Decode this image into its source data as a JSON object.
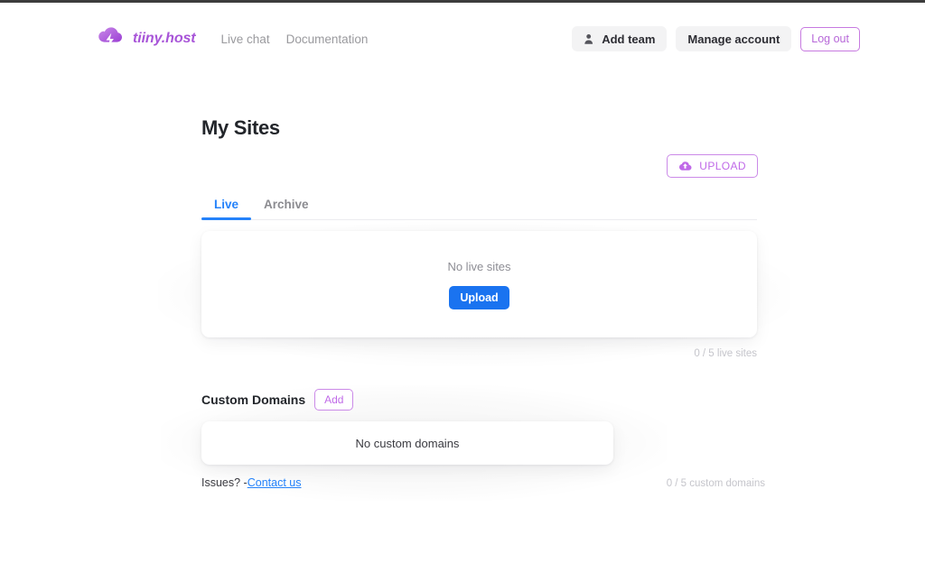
{
  "brand": {
    "name": "tiiny.host",
    "logo_icon": "cloud-bolt-icon",
    "accent_purple": "#b768d8"
  },
  "header": {
    "nav_links": [
      {
        "label": "Live chat"
      },
      {
        "label": "Documentation"
      }
    ],
    "actions": {
      "add_team_label": "Add team",
      "add_team_icon": "user-icon",
      "manage_account_label": "Manage account",
      "log_out_label": "Log out"
    }
  },
  "main": {
    "title": "My Sites",
    "upload_button": {
      "label": "UPLOAD",
      "icon": "cloud-upload-icon"
    },
    "tabs": [
      {
        "label": "Live",
        "active": true
      },
      {
        "label": "Archive",
        "active": false
      }
    ],
    "sites_panel": {
      "empty_message": "No live sites",
      "upload_button_label": "Upload",
      "counter": "0 / 5 live sites"
    }
  },
  "custom_domains": {
    "title": "Custom Domains",
    "add_button_label": "Add",
    "empty_message": "No custom domains",
    "issues_text": "Issues? -",
    "contact_link_label": "Contact us",
    "counter": "0 / 5 custom domains"
  },
  "colors": {
    "blue": "#1a73f0",
    "tab_active": "#2482fa",
    "purple": "#c06ae8",
    "muted": "#c5c5cb"
  }
}
